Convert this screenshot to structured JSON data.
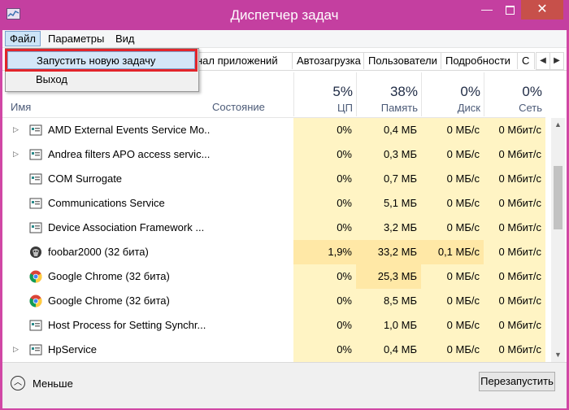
{
  "window": {
    "title": "Диспетчер задач",
    "min": "—",
    "close": "✕"
  },
  "menu": {
    "file": "Файл",
    "params": "Параметры",
    "view": "Вид"
  },
  "file_menu": {
    "new_task": "Запустить новую задачу",
    "exit": "Выход"
  },
  "tabs": {
    "history": "нал приложений",
    "startup": "Автозагрузка",
    "users": "Пользователи",
    "details": "Подробности",
    "services": "С",
    "prev": "◀",
    "next": "▶"
  },
  "headers": {
    "name": "Имя",
    "status": "Состояние",
    "cpu": {
      "pct": "5%",
      "label": "ЦП"
    },
    "memory": {
      "pct": "38%",
      "label": "Память"
    },
    "disk": {
      "pct": "0%",
      "label": "Диск"
    },
    "network": {
      "pct": "0%",
      "label": "Сеть"
    }
  },
  "processes": [
    {
      "name": "AMD External Events Service Mo...",
      "expand": "▷",
      "icon": "service-icon",
      "cpu": "0%",
      "memory": "0,4 МБ",
      "disk": "0 МБ/с",
      "network": "0 Мбит/с"
    },
    {
      "name": "Andrea filters APO access servic...",
      "expand": "▷",
      "icon": "service-icon",
      "cpu": "0%",
      "memory": "0,3 МБ",
      "disk": "0 МБ/с",
      "network": "0 Мбит/с"
    },
    {
      "name": "COM Surrogate",
      "expand": "",
      "icon": "service-icon",
      "cpu": "0%",
      "memory": "0,7 МБ",
      "disk": "0 МБ/с",
      "network": "0 Мбит/с"
    },
    {
      "name": "Communications Service",
      "expand": "",
      "icon": "service-icon",
      "cpu": "0%",
      "memory": "5,1 МБ",
      "disk": "0 МБ/с",
      "network": "0 Мбит/с"
    },
    {
      "name": "Device Association Framework ...",
      "expand": "",
      "icon": "service-icon",
      "cpu": "0%",
      "memory": "3,2 МБ",
      "disk": "0 МБ/с",
      "network": "0 Мбит/с"
    },
    {
      "name": "foobar2000 (32 бита)",
      "expand": "",
      "icon": "foobar-icon",
      "cpu": "1,9%",
      "memory": "33,2 МБ",
      "disk": "0,1 МБ/с",
      "network": "0 Мбит/с"
    },
    {
      "name": "Google Chrome (32 бита)",
      "expand": "",
      "icon": "chrome-icon",
      "cpu": "0%",
      "memory": "25,3 МБ",
      "disk": "0 МБ/с",
      "network": "0 Мбит/с"
    },
    {
      "name": "Google Chrome (32 бита)",
      "expand": "",
      "icon": "chrome-icon",
      "cpu": "0%",
      "memory": "8,5 МБ",
      "disk": "0 МБ/с",
      "network": "0 Мбит/с"
    },
    {
      "name": "Host Process for Setting Synchr...",
      "expand": "",
      "icon": "service-icon",
      "cpu": "0%",
      "memory": "1,0 МБ",
      "disk": "0 МБ/с",
      "network": "0 Мбит/с"
    },
    {
      "name": "HpService",
      "expand": "▷",
      "icon": "service-icon",
      "cpu": "0%",
      "memory": "0,4 МБ",
      "disk": "0 МБ/с",
      "network": "0 Мбит/с"
    }
  ],
  "footer": {
    "less": "Меньше",
    "restart": "Перезапустить"
  },
  "colors": {
    "titlebar": "#c43fa0",
    "close": "#c7504a",
    "heat_light": "#fff4c4",
    "heat_mid": "#ffe8a6",
    "highlight_box": "#e2252b"
  }
}
